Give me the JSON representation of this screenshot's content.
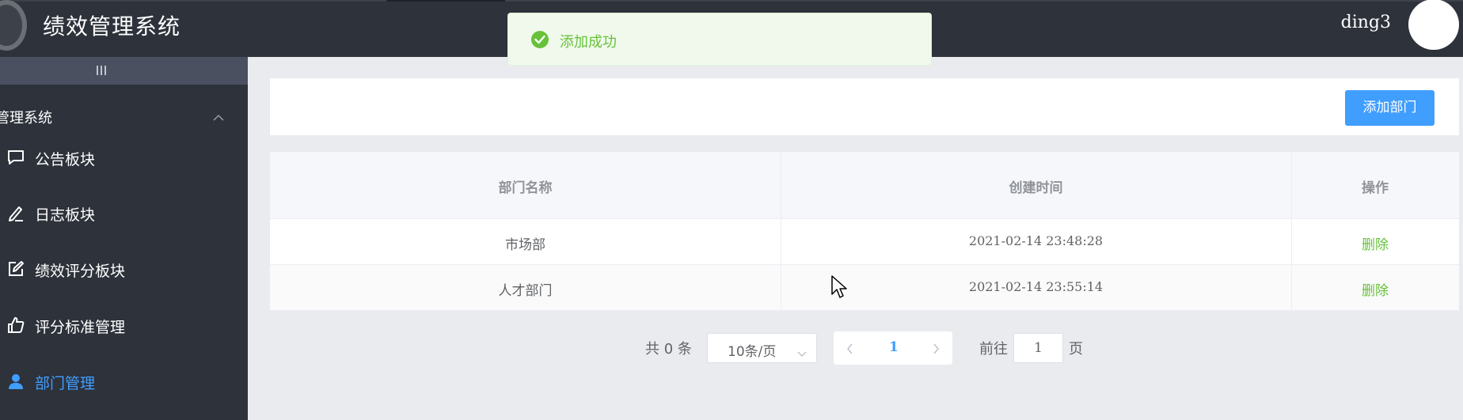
{
  "header": {
    "title": "绩效管理系统",
    "username": "ding3"
  },
  "toast": {
    "message": "添加成功",
    "type": "success",
    "color": "#67c23a"
  },
  "sidebar": {
    "group_label": "管理系统",
    "items": [
      {
        "label": "公告板块",
        "icon": "message-square-icon",
        "active": false
      },
      {
        "label": "日志板块",
        "icon": "pen-icon",
        "active": false
      },
      {
        "label": "绩效评分板块",
        "icon": "edit-icon",
        "active": false
      },
      {
        "label": "评分标准管理",
        "icon": "thumb-up-icon",
        "active": false
      },
      {
        "label": "部门管理",
        "icon": "user-icon",
        "active": true
      }
    ]
  },
  "toolbar": {
    "add_button_label": "添加部门"
  },
  "table": {
    "columns": [
      "部门名称",
      "创建时间",
      "操作"
    ],
    "rows": [
      {
        "name": "市场部",
        "created": "2021-02-14 23:48:28",
        "action": "删除"
      },
      {
        "name": "人才部门",
        "created": "2021-02-14 23:55:14",
        "action": "删除"
      }
    ]
  },
  "pagination": {
    "total_text": "共 0 条",
    "page_size": "10条/页",
    "current_page": "1",
    "goto_label": "前往",
    "goto_value": "1",
    "page_suffix": "页"
  },
  "colors": {
    "header_bg": "#2d323b",
    "accent": "#409eff",
    "danger_link": "#67c23a"
  }
}
